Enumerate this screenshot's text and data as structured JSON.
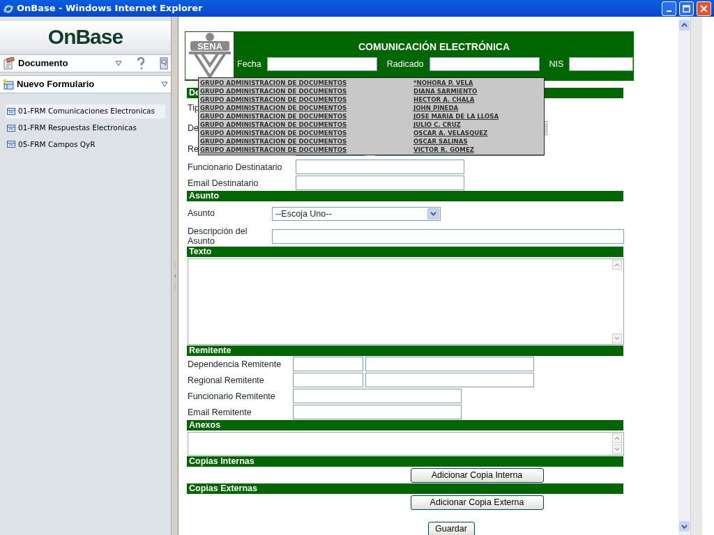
{
  "window": {
    "title": "OnBase - Windows Internet Explorer"
  },
  "sidebar": {
    "logo": "OnBase",
    "document_menu": "Documento",
    "form_menu": "Nuevo Formulario",
    "items": [
      {
        "label": "01-FRM Comunicaciones Electronicas",
        "selected": true
      },
      {
        "label": "01-FRM Respuestas Electronicas",
        "selected": false
      },
      {
        "label": "05-FRM Campos QyR",
        "selected": false
      }
    ]
  },
  "form": {
    "logo": "SENA",
    "title": "COMUNICACIÓN ELECTRÓNICA",
    "header_fields": [
      {
        "label": "Fecha"
      },
      {
        "label": "Radicado"
      },
      {
        "label": "NIS"
      }
    ],
    "sections": [
      {
        "title": "De",
        "rows": [
          {
            "label": "Tip",
            "kind": "blank"
          },
          {
            "label": "De",
            "kind": "select"
          },
          {
            "label": "Re",
            "kind": "pair-wide"
          },
          {
            "label": "Funcionario Destinatario",
            "kind": "text"
          },
          {
            "label": "Email Destinatario",
            "kind": "text"
          }
        ]
      },
      {
        "title": "Asunto",
        "rows": [
          {
            "label": "Asunto",
            "kind": "select",
            "value": "--Escoja Uno--"
          },
          {
            "label": "Descripción del Asunto",
            "kind": "wide"
          }
        ]
      },
      {
        "title": "Texto",
        "rows": [
          {
            "kind": "textarea-tall"
          }
        ]
      },
      {
        "title": "Remitente",
        "rows": [
          {
            "label": "Dependencia Remitente",
            "kind": "pair"
          },
          {
            "label": "Regional Remitente",
            "kind": "pair"
          },
          {
            "label": "Funcionario Remitente",
            "kind": "text"
          },
          {
            "label": "Email Remitente",
            "kind": "text"
          }
        ]
      },
      {
        "title": "Anexos",
        "rows": [
          {
            "kind": "textarea-short"
          }
        ]
      },
      {
        "title": "Copias Internas",
        "rows": [
          {
            "kind": "button",
            "label": "Adicionar Copia Interna"
          }
        ]
      },
      {
        "title": "Copias Externas",
        "rows": [
          {
            "kind": "button",
            "label": "Adicionar Copia Externa"
          }
        ]
      }
    ],
    "submit": "Guardar"
  },
  "dropdown_list": [
    {
      "column_1": "GRUPO ADMINISTRACION DE DOCUMENTOS",
      "column_2": "*NOHORA P. VELA"
    },
    {
      "column_1": "GRUPO ADMINISTRACION DE DOCUMENTOS",
      "column_2": "DIANA SARMIENTO"
    },
    {
      "column_1": "GRUPO ADMINISTRACION DE DOCUMENTOS",
      "column_2": "HECTOR A. CHALA"
    },
    {
      "column_1": "GRUPO ADMINISTRACION DE DOCUMENTOS",
      "column_2": "JOHN PINEDA"
    },
    {
      "column_1": "GRUPO ADMINISTRACION DE DOCUMENTOS",
      "column_2": "JOSE MARIA DE LA LLOSA"
    },
    {
      "column_1": "GRUPO ADMINISTRACION DE DOCUMENTOS",
      "column_2": "JULIO C. CRUZ"
    },
    {
      "column_1": "GRUPO ADMINISTRACION DE DOCUMENTOS",
      "column_2": "OSCAR A. VELASQUEZ"
    },
    {
      "column_1": "GRUPO ADMINISTRACION DE DOCUMENTOS",
      "column_2": "OSCAR SALINAS"
    },
    {
      "column_1": "GRUPO ADMINISTRACION DE DOCUMENTOS",
      "column_2": "VICTOR R. GOMEZ"
    }
  ]
}
